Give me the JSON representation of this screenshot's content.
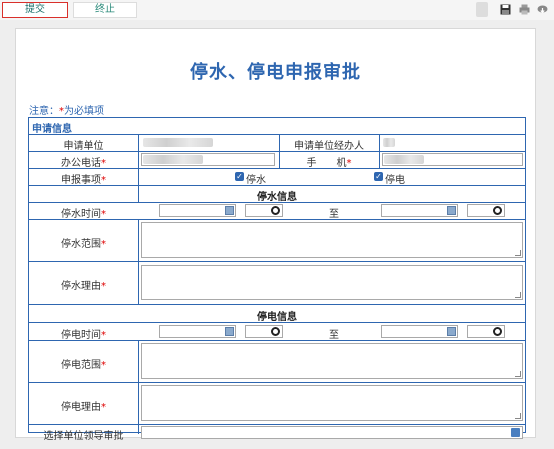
{
  "toolbar": {
    "submit_label": "提交",
    "stop_label": "终止"
  },
  "form": {
    "title": "停水、停电申报审批",
    "note_prefix": "注意：",
    "note_star": "*",
    "note_suffix": "为必填项",
    "section_title": "申请信息",
    "labels": {
      "unit": "申请单位",
      "handler": "申请单位经办人",
      "office_phone": "办公电话",
      "mobile": "手　　机",
      "item": "申报事项",
      "water_stop_time": "停水时间",
      "water_range": "停水范围",
      "water_reason": "停水理由",
      "power_stop_time": "停电时间",
      "power_range": "停电范围",
      "power_reason": "停电理由",
      "leader": "选择单位领导审批",
      "to": "至",
      "required": "*"
    },
    "checkboxes": {
      "water": "停水",
      "power": "停电"
    },
    "subsections": {
      "water": "停水信息",
      "power": "停电信息"
    }
  }
}
